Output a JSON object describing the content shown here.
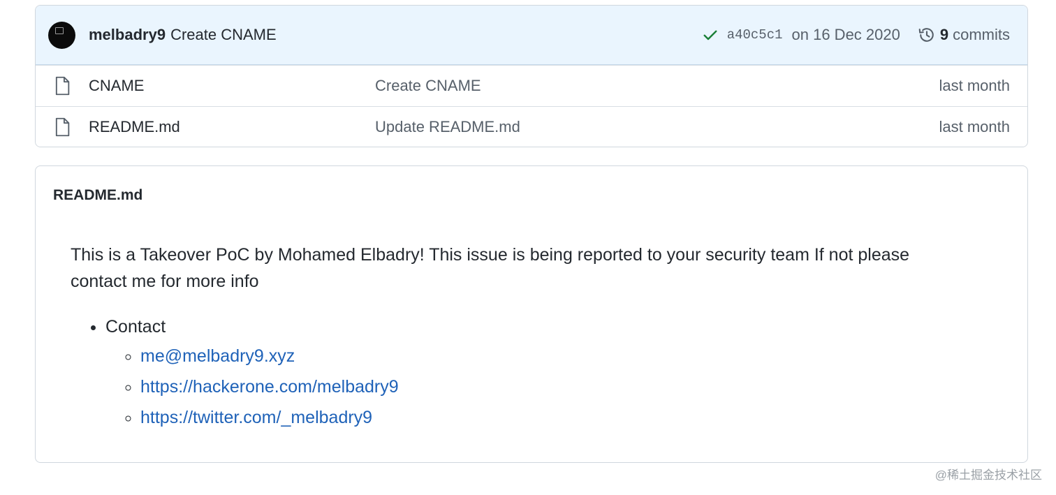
{
  "commit_bar": {
    "author": "melbadry9",
    "message": "Create CNAME",
    "sha": "a40c5c1",
    "date": "on 16 Dec 2020",
    "commits_count": "9",
    "commits_label": "commits",
    "status_color": "#1a7f37"
  },
  "files": [
    {
      "icon": "file-icon",
      "name": "CNAME",
      "last_commit": "Create CNAME",
      "age": "last month"
    },
    {
      "icon": "file-icon",
      "name": "README.md",
      "last_commit": "Update README.md",
      "age": "last month"
    }
  ],
  "readme": {
    "title": "README.md",
    "paragraph": "This is a Takeover PoC by Mohamed Elbadry! This issue is being reported to your security team If not please contact me for more info",
    "list_item": "Contact",
    "links": [
      "me@melbadry9.xyz",
      "https://hackerone.com/melbadry9",
      "https://twitter.com/_melbadry9"
    ],
    "link_color": "#1f62b8"
  },
  "watermark": "@稀土掘金技术社区"
}
